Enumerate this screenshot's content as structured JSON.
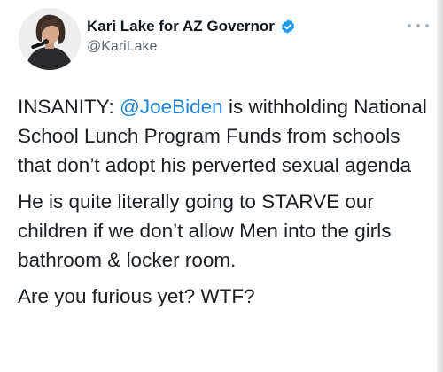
{
  "tweet": {
    "author": {
      "display_name": "Kari Lake for AZ Governor",
      "handle": "@KariLake",
      "verified": true,
      "verified_icon": "verified-badge-icon",
      "avatar_icon": "profile-photo",
      "more_icon": "more-options-icon"
    },
    "paragraph1": {
      "prefix": "INSANITY: ",
      "mention": "@JoeBiden",
      "suffix": " is withholding National School Lunch Program Funds from schools that don’t adopt his perverted sexual agenda"
    },
    "paragraph2": "He is quite literally going to STARVE our children if we don’t allow Men into the girls bathroom & locker room.",
    "paragraph3": "Are you furious yet? WTF?"
  },
  "colors": {
    "mention": "#1d83d6",
    "verified_badge": "#1d9bf0",
    "text": "#1b1e22",
    "handle": "#5b6673"
  }
}
